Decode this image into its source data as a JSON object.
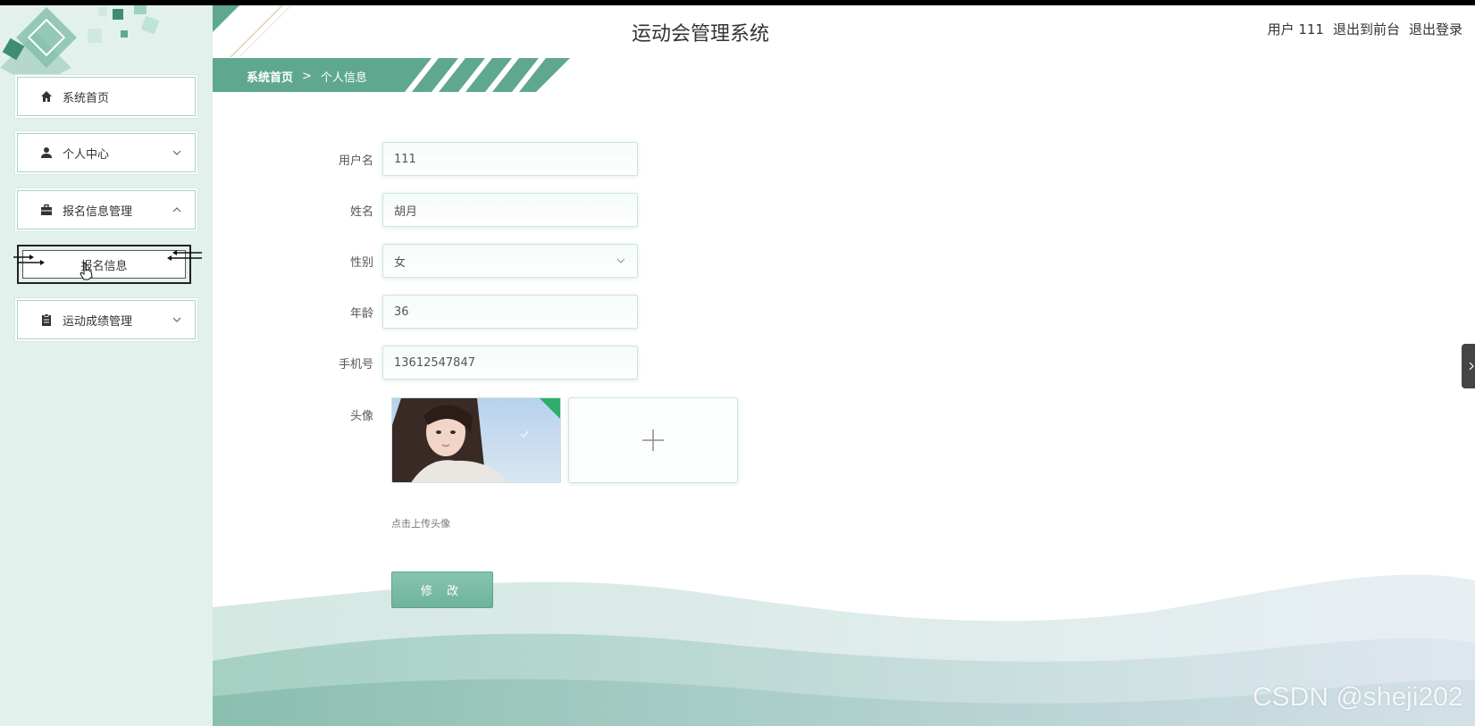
{
  "header": {
    "app_title": "运动会管理系统",
    "user_label": "用户 111",
    "front_link": "退出到前台",
    "logout_link": "退出登录"
  },
  "breadcrumb": {
    "home": "系统首页",
    "separator": ">",
    "current": "个人信息"
  },
  "sidebar": {
    "items": [
      {
        "label": "系统首页",
        "icon": "home-icon"
      },
      {
        "label": "个人中心",
        "icon": "user-icon"
      },
      {
        "label": "报名信息管理",
        "icon": "briefcase-icon"
      },
      {
        "label": "运动成绩管理",
        "icon": "clipboard-icon"
      }
    ],
    "sub_item": "报名信息"
  },
  "form": {
    "username_label": "用户名",
    "username_value": "111",
    "name_label": "姓名",
    "name_value": "胡月",
    "gender_label": "性别",
    "gender_value": "女",
    "age_label": "年龄",
    "age_value": "36",
    "phone_label": "手机号",
    "phone_value": "13612547847",
    "avatar_label": "头像",
    "upload_hint": "点击上传头像",
    "submit_label": "修 改"
  },
  "watermark": "CSDN @sheji202",
  "colors": {
    "accent": "#5fa88f",
    "sidebar_bg": "#e3f1ec",
    "border": "#a9d3c5"
  }
}
